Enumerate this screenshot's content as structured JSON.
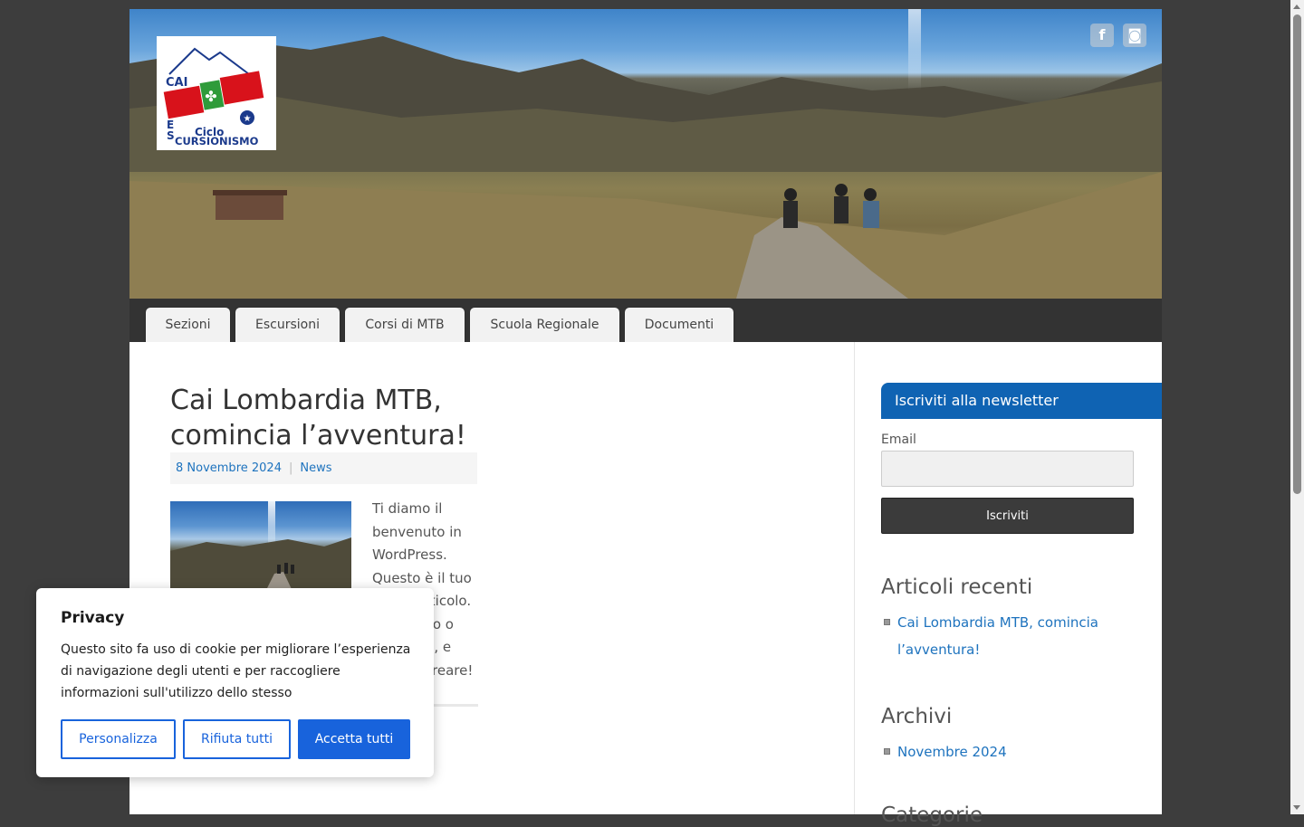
{
  "header": {
    "logo": {
      "text_cai": "CAI",
      "text_ciclo": "Ciclo",
      "text_e": "E",
      "text_s": "S",
      "text_cursionismo": "CURSIONISMO"
    },
    "social_icons": [
      "facebook-icon",
      "instagram-icon"
    ]
  },
  "nav": {
    "items": [
      {
        "label": "Sezioni"
      },
      {
        "label": "Escursioni"
      },
      {
        "label": "Corsi di MTB"
      },
      {
        "label": "Scuola Regionale"
      },
      {
        "label": "Documenti"
      }
    ]
  },
  "post": {
    "title": "Cai Lombardia MTB, comincia l’avventura!",
    "date": "8 Novembre 2024",
    "category": "News",
    "excerpt": "Ti diamo il benvenuto in WordPress. Questo è il tuo primo articolo. Modificalo o eliminalo, e inizia a creare!"
  },
  "sidebar": {
    "newsletter": {
      "title": "Iscriviti alla newsletter",
      "email_label": "Email",
      "email_value": "",
      "button_label": "Iscriviti"
    },
    "recent": {
      "title": "Articoli recenti",
      "items": [
        {
          "label": "Cai Lombardia MTB, comincia l’avventura!"
        }
      ]
    },
    "archives": {
      "title": "Archivi",
      "items": [
        {
          "label": "Novembre 2024"
        }
      ]
    },
    "categories": {
      "title": "Categorie"
    }
  },
  "cookie_banner": {
    "title": "Privacy",
    "text": "Questo sito fa uso di cookie per migliorare l’esperienza di navigazione degli utenti e per raccogliere informazioni sull'utilizzo dello stesso",
    "customize_label": "Personalizza",
    "reject_label": "Rifiuta tutti",
    "accept_label": "Accetta tutti"
  },
  "colors": {
    "accent": "#0f63b3",
    "link": "#1e73be",
    "cookie_button": "#1863dc",
    "nav_bar": "#333333"
  }
}
